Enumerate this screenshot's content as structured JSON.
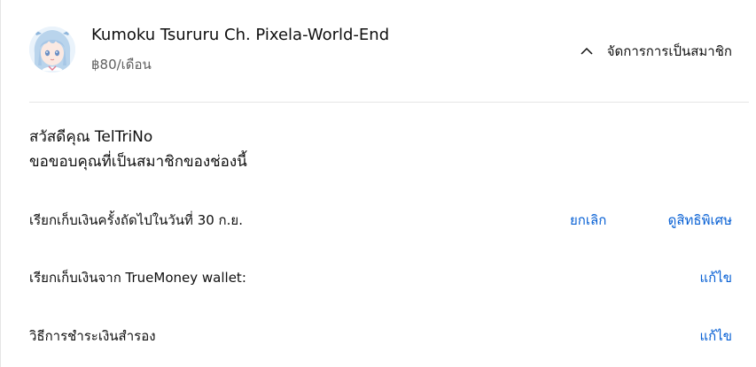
{
  "membership": {
    "channel_name": "Kumoku Tsururu Ch. Pixela-World-End",
    "price": "฿80/เดือน",
    "manage_label": "จัดการการเป็นสมาชิก"
  },
  "greeting": {
    "line1": "สวัสดีคุณ TelTriNo",
    "line2": "ขอขอบคุณที่เป็นสมาชิกของช่องนี้"
  },
  "billing": {
    "next_charge": "เรียกเก็บเงินครั้งถัดไปในวันที่ 30 ก.ย.",
    "cancel_label": "ยกเลิก",
    "perks_label": "ดูสิทธิพิเศษ"
  },
  "payment": {
    "source": "เรียกเก็บเงินจาก TrueMoney wallet:",
    "edit_label": "แก้ไข"
  },
  "backup": {
    "label": "วิธีการชำระเงินสำรอง",
    "edit_label": "แก้ไข"
  },
  "colors": {
    "link": "#065fd4",
    "secondary_text": "#606060",
    "divider": "#e5e5e5"
  },
  "icons": {
    "manage": "chevron-up-icon",
    "avatar": "channel-avatar"
  }
}
